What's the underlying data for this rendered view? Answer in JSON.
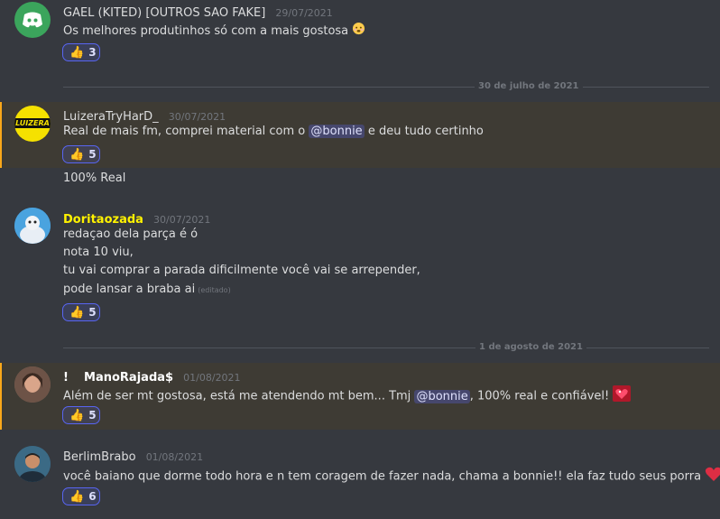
{
  "colors": {
    "background": "#36393f",
    "mention_highlight": "#3e3b34",
    "mention_bar": "#faa81a",
    "reaction_border": "#5865f2",
    "name_yellow": "#fff200",
    "discord_green": "#3ba55c"
  },
  "messages": [
    {
      "author": "GAEL (KITED) [OUTROS SAO FAKE]",
      "timestamp": "29/07/2021",
      "lines": [
        "Os melhores produtinhos só com a mais gostosa"
      ],
      "reaction_count": "3"
    },
    {
      "author": "LuizeraTryHarD_",
      "timestamp": "30/07/2021",
      "avatar_text": "LUIZERA",
      "line_before_mention": "Real de mais fm, comprei material com o ",
      "mention": "@bonnie",
      "line_after_mention": " e deu tudo certinho",
      "reaction_count": "5",
      "followup": "100% Real"
    },
    {
      "author": "Doritaozada",
      "timestamp": "30/07/2021",
      "lines": [
        "redaçao dela parça é ó",
        "nota 10  viu,",
        "tu vai comprar a parada dificilmente você vai se arrepender,",
        "pode lansar a braba ai"
      ],
      "edited": "(editado)",
      "reaction_count": "5"
    },
    {
      "author_prefix": "!",
      "author": "ManoRajada$",
      "timestamp": "01/08/2021",
      "line_before_mention": "Além de ser mt gostosa, está me atendendo mt bem... Tmj ",
      "mention": "@bonnie",
      "line_after_mention": ", 100% real e confiável!",
      "reaction_count": "5"
    },
    {
      "author": "BerlimBrabo",
      "timestamp": "01/08/2021",
      "lines": [
        "você baiano que dorme todo hora e n tem coragem de fazer nada, chama a bonnie!! ela faz tudo seus porra"
      ],
      "reaction_count": "6"
    }
  ],
  "dividers": [
    "30 de julho de 2021",
    "1 de agosto de 2021"
  ]
}
